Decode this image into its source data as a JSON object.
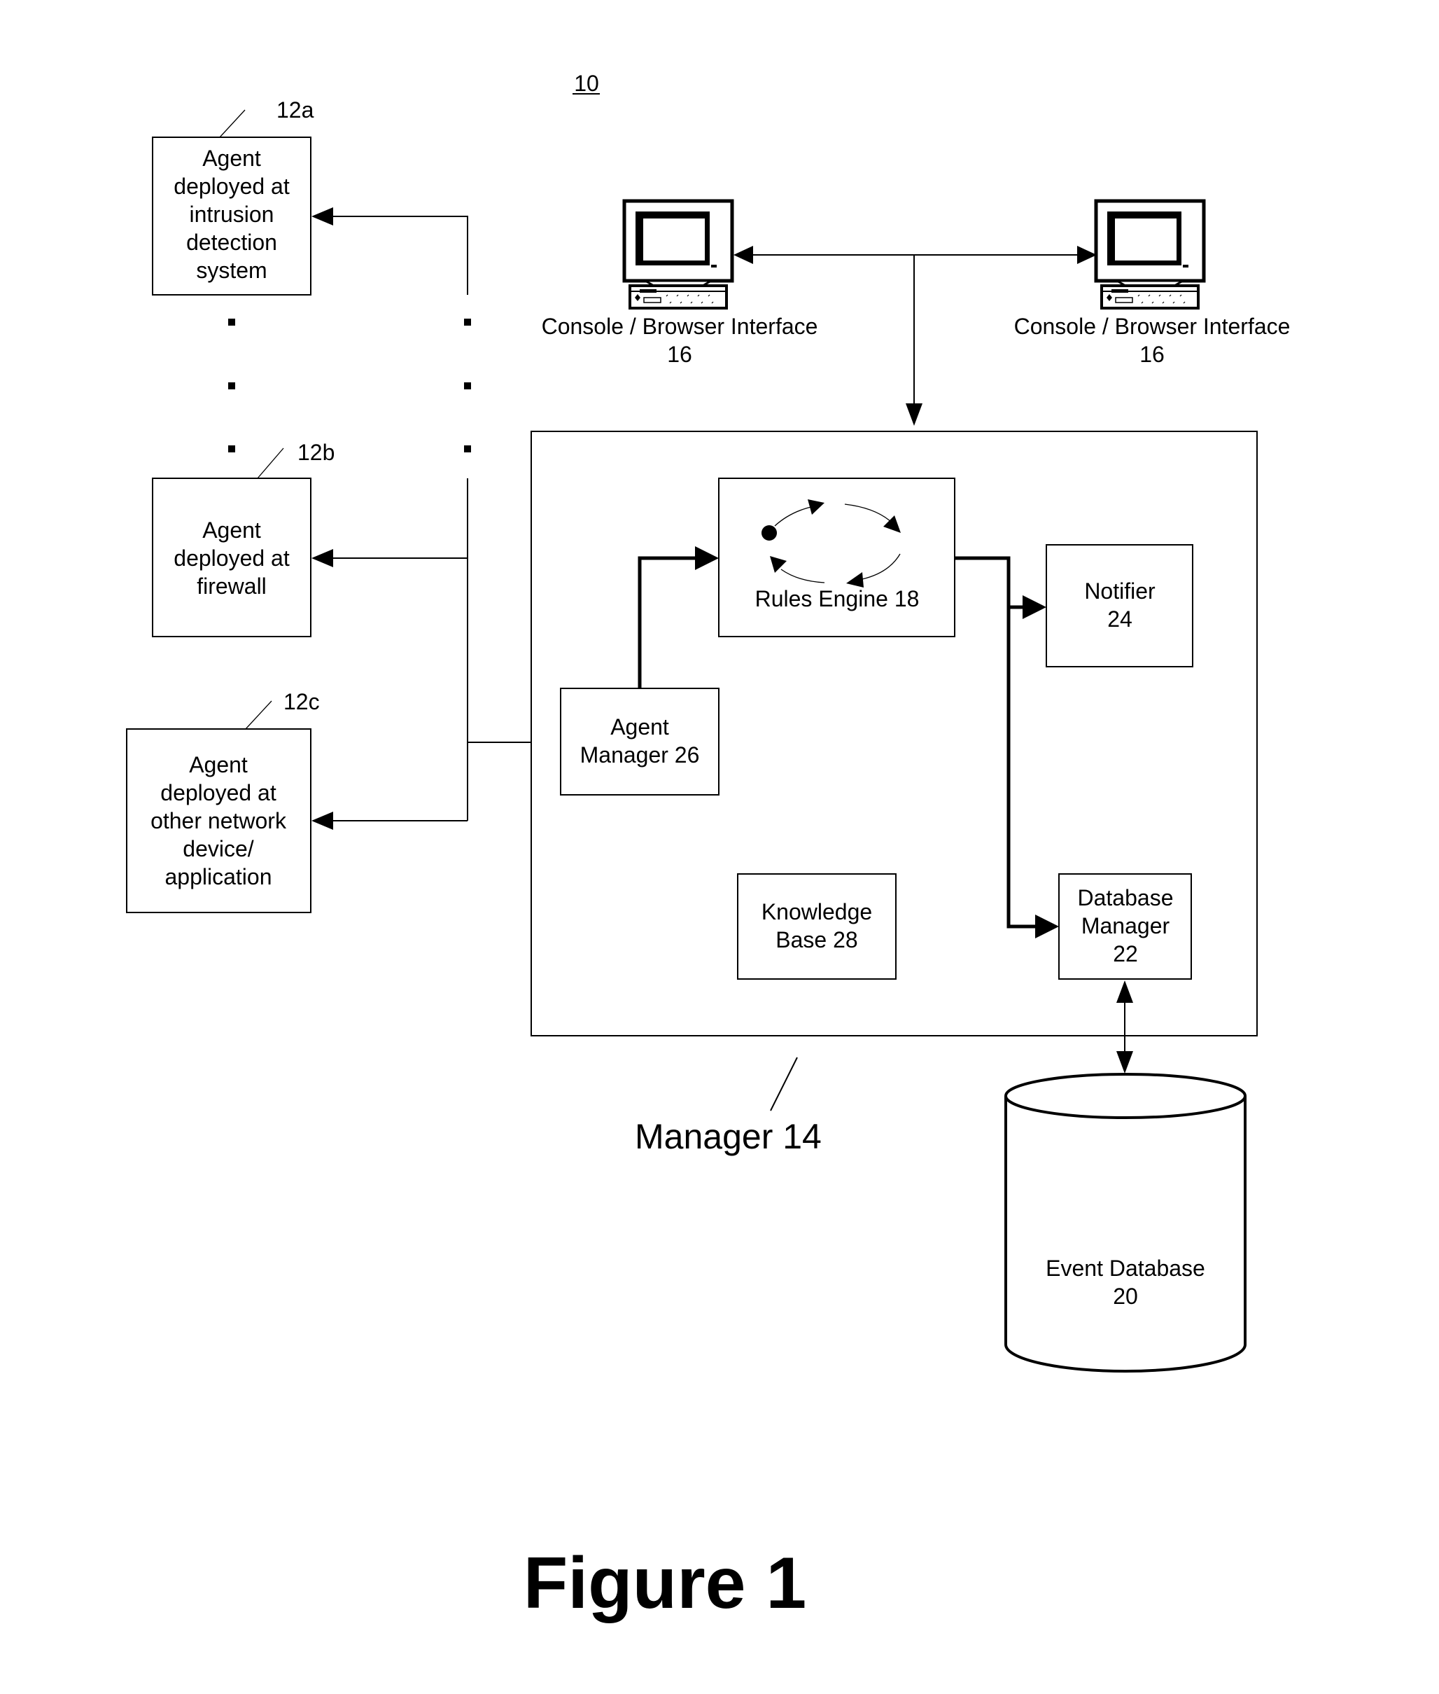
{
  "figure": {
    "system_ref": "10",
    "caption": "Figure 1"
  },
  "agents": [
    {
      "ref": "12a",
      "lines": [
        "Agent",
        "deployed at",
        "intrusion",
        "detection",
        "system"
      ]
    },
    {
      "ref": "12b",
      "lines": [
        "Agent",
        "deployed at",
        "firewall"
      ]
    },
    {
      "ref": "12c",
      "lines": [
        "Agent",
        "deployed at",
        "other network",
        "device/",
        "application"
      ]
    }
  ],
  "consoles": [
    {
      "icon": "computer-icon",
      "label": "Console / Browser Interface",
      "ref": "16"
    },
    {
      "icon": "computer-icon",
      "label": "Console / Browser Interface",
      "ref": "16"
    }
  ],
  "manager": {
    "label": "Manager 14",
    "components": {
      "rules_engine": {
        "label": "Rules Engine 18",
        "icon": "cycle-arrows-icon"
      },
      "agent_manager": {
        "lines": [
          "Agent",
          "Manager 26"
        ]
      },
      "notifier": {
        "lines": [
          "Notifier",
          "24"
        ]
      },
      "knowledge_base": {
        "lines": [
          "Knowledge",
          "Base 28"
        ]
      },
      "database_manager": {
        "lines": [
          "Database",
          "Manager",
          "22"
        ]
      }
    }
  },
  "event_database": {
    "icon": "database-cylinder-icon",
    "lines": [
      "Event Database",
      "20"
    ]
  },
  "colors": {
    "ink": "#000000",
    "paper": "#ffffff"
  }
}
